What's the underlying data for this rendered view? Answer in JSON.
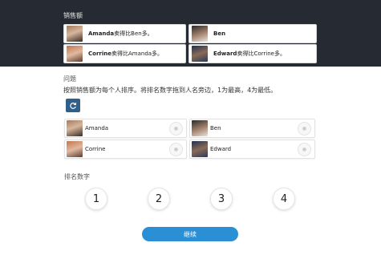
{
  "clues_section": {
    "title": "销售额",
    "cards": [
      {
        "name": "Amanda",
        "text": "卖得比Ben多。",
        "avatar": "Amanda-photo"
      },
      {
        "name": "Ben",
        "text": "",
        "avatar": "Ben-photo"
      },
      {
        "name": "Corrine",
        "text": "卖得比Amanda多。",
        "avatar": "Corrine-photo"
      },
      {
        "name": "Edward",
        "text": "卖得比Corrine多。",
        "avatar": "Edward-photo"
      }
    ]
  },
  "question": {
    "label": "问题",
    "text": "按照销售额为每个人排序。将排名数字拖到人名旁边，1为最高，4为最低。",
    "shuffle_icon": "refresh-icon"
  },
  "rank_cards": [
    {
      "name": "Amanda"
    },
    {
      "name": "Ben"
    },
    {
      "name": "Corrine"
    },
    {
      "name": "Edward"
    }
  ],
  "rank_numbers": {
    "label": "排名数字",
    "values": [
      "1",
      "2",
      "3",
      "4"
    ]
  },
  "continue_button": {
    "label": "继续"
  },
  "colors": {
    "top_panel": "#262a33",
    "shuffle_button": "#2f5f8a",
    "continue_button": "#2b8fd6"
  }
}
